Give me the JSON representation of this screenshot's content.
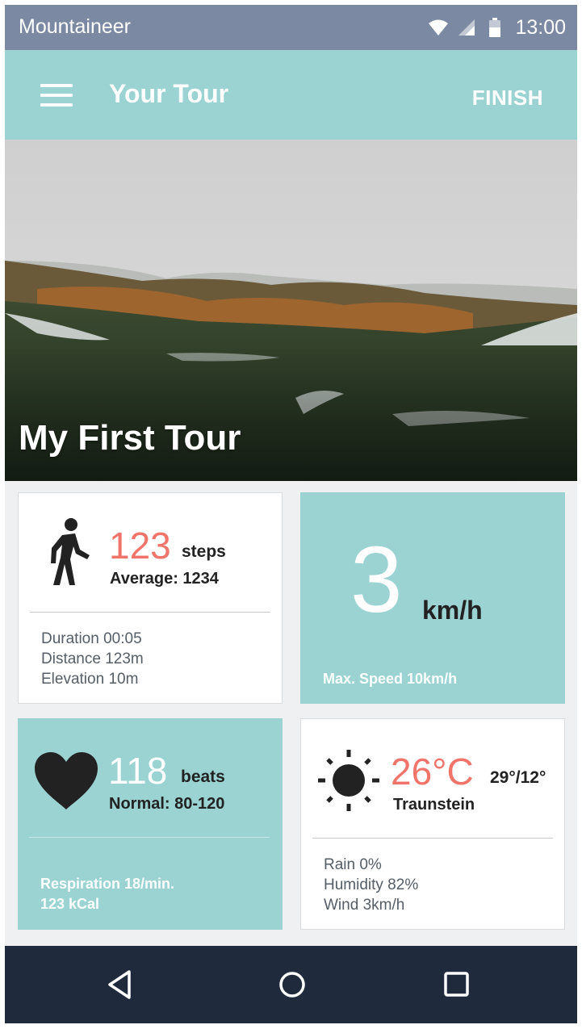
{
  "status_bar": {
    "app_name": "Mountaineer",
    "time": "13:00",
    "icons": [
      "wifi-icon",
      "signal-icon",
      "battery-icon"
    ]
  },
  "app_bar": {
    "title": "Your Tour",
    "action": "FINISH",
    "menu_icon": "hamburger-menu-icon"
  },
  "hero": {
    "title": "My First Tour"
  },
  "steps_card": {
    "icon": "walking-person-icon",
    "value": "123",
    "unit": "steps",
    "average": "Average: 1234",
    "duration": "Duration 00:05",
    "distance": "Distance 123m",
    "elevation": "Elevation 10m"
  },
  "speed_card": {
    "value": "3",
    "unit": "km/h",
    "max_speed": "Max. Speed 10km/h"
  },
  "heart_card": {
    "icon": "heart-icon",
    "value": "118",
    "unit": "beats",
    "normal": "Normal: 80-120",
    "respiration": "Respiration 18/min.",
    "calories": "123 kCal"
  },
  "weather_card": {
    "icon": "sun-icon",
    "temperature": "26°C",
    "high_low": "29°/12°",
    "location": "Traunstein",
    "rain": "Rain 0%",
    "humidity": "Humidity 82%",
    "wind": "Wind 3km/h"
  },
  "nav_bar": {
    "buttons": [
      "back-triangle-icon",
      "home-circle-icon",
      "recents-square-icon"
    ]
  },
  "colors": {
    "accent_teal": "#9ad3d2",
    "status_bar": "#7b8aa2",
    "highlight_coral": "#f1746a",
    "nav_bar": "#1f2b3c"
  }
}
